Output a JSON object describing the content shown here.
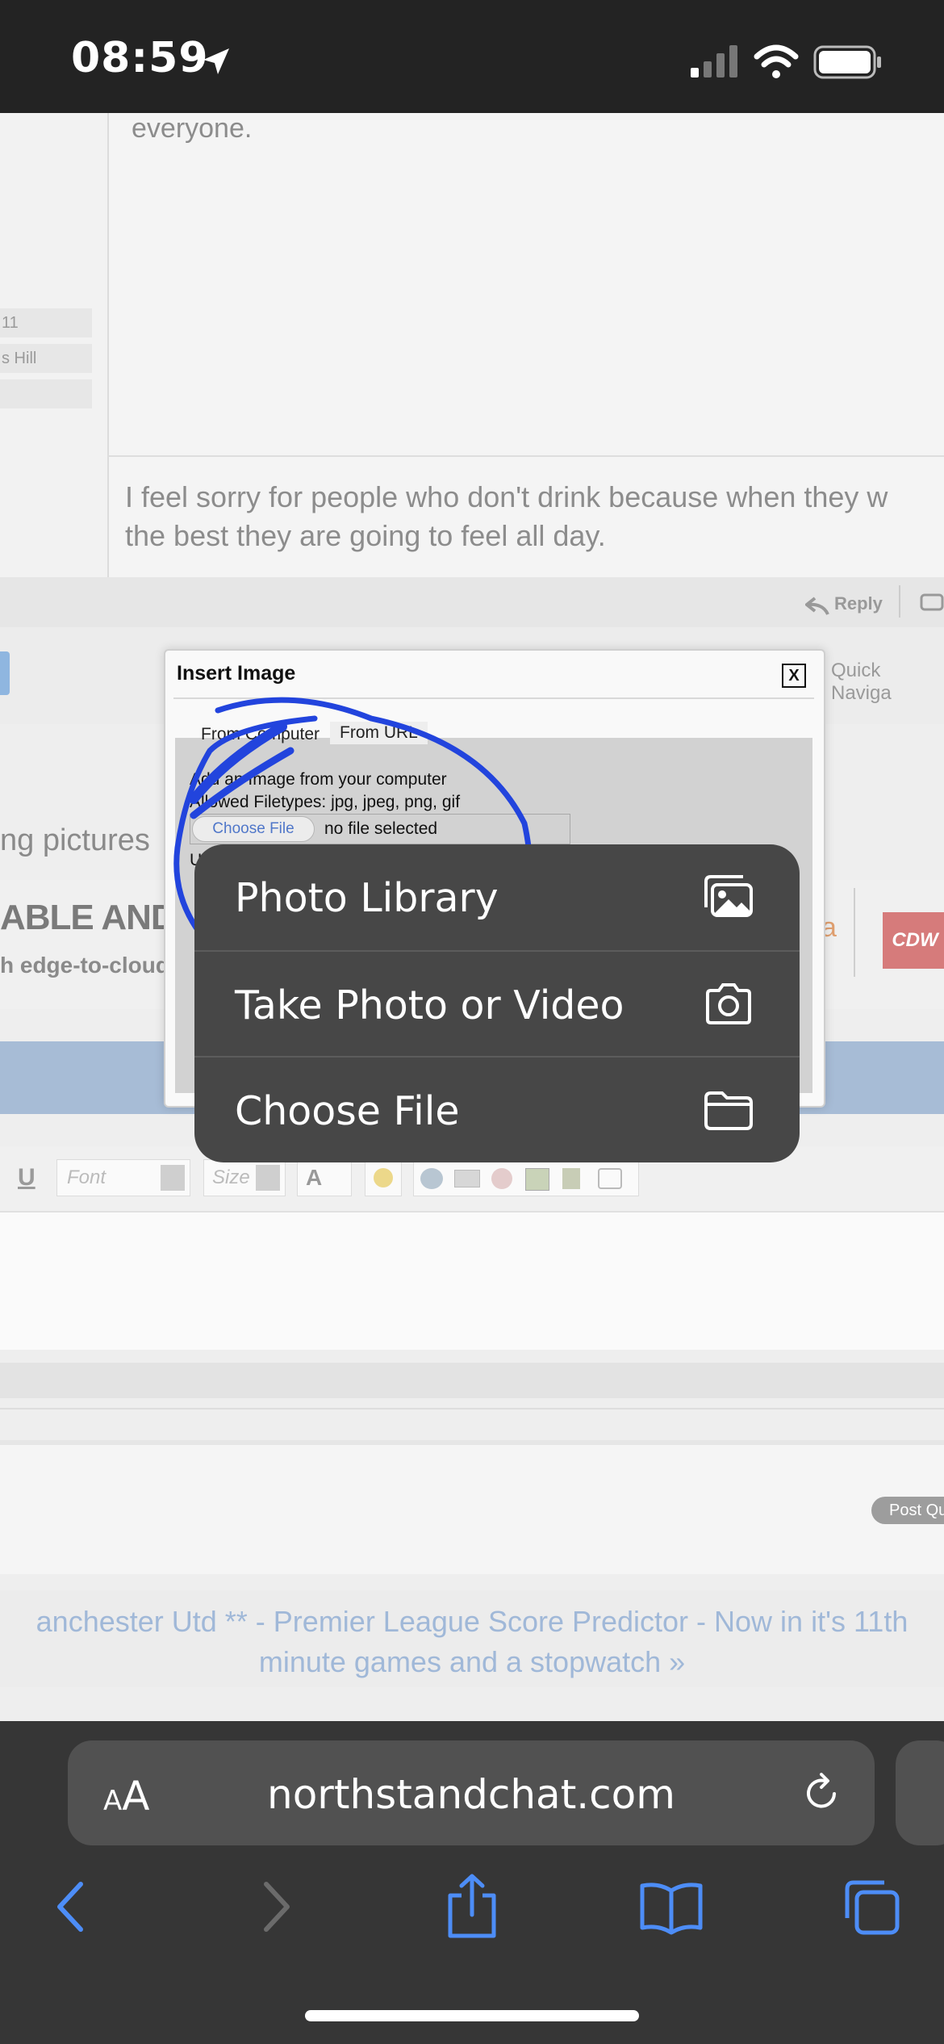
{
  "status": {
    "time": "08:59"
  },
  "post": {
    "top_text": "everyone.",
    "user_fields": [
      "11",
      "s Hill",
      ""
    ],
    "signature": [
      "I feel sorry for people who don't drink because when they w",
      "the best they are going to feel all day."
    ],
    "reply_label": "Reply"
  },
  "dialog": {
    "title": "Insert Image",
    "close_label": "X",
    "tab_computer": "From Computer",
    "tab_url": "From URL",
    "add_text": "Add an Image from your computer",
    "filetypes_text": "Allowed Filetypes: jpg, jpeg, png, gif",
    "choose_file_label": "Choose File",
    "no_file_text": "no file selected",
    "upload_fragment": "U"
  },
  "page": {
    "quick_nav": "Quick Naviga",
    "side_fragment": "ng pictures",
    "ad_headline": "ABLE AND SEC",
    "ad_sub": "h edge-to-cloud, ze",
    "ad_logo": "CDW",
    "toolbar": {
      "underline": "U",
      "font_placeholder": "Font",
      "size_placeholder": "Size",
      "color_label": "A"
    },
    "post_quick": "Post Qu",
    "footer_line1": "anchester Utd ** - Premier League Score Predictor - Now in it's 11th",
    "footer_line2": "minute games and a stopwatch »"
  },
  "popup": {
    "items": [
      {
        "label": "Photo Library",
        "icon": "photo-library-icon"
      },
      {
        "label": "Take Photo or Video",
        "icon": "camera-icon"
      },
      {
        "label": "Choose File",
        "icon": "folder-icon"
      }
    ]
  },
  "safari": {
    "aa_label": "AA",
    "url": "northstandchat.com"
  },
  "colors": {
    "annotation_blue": "#2244dd",
    "link_blue": "#3d7ee9",
    "popup_bg": "#474747"
  }
}
